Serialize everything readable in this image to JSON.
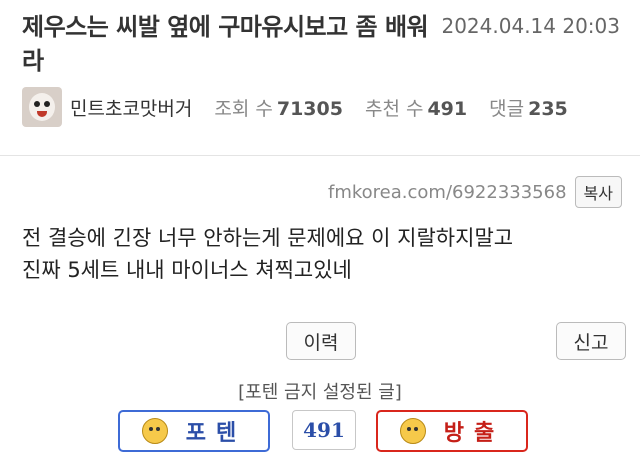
{
  "post": {
    "title": "제우스는 씨발 옆에 구마유시보고 좀 배워라",
    "date": "2024.04.14 20:03",
    "author": "민트초코맛버거",
    "views_label": "조회 수",
    "views": "71305",
    "recommend_label": "추천 수",
    "recommend": "491",
    "comments_label": "댓글",
    "comments": "235",
    "url": "fmkorea.com/6922333568",
    "copy_label": "복사",
    "body_line1": "전 결승에 긴장 너무 안하는게 문제에요 이 지랄하지말고",
    "body_line2": "진짜 5세트 내내 마이너스 쳐찍고있네"
  },
  "actions": {
    "history_label": "이력",
    "report_label": "신고",
    "notice": "[포텐 금지 설정된 글]",
    "upvote_label": "포텐",
    "downvote_label": "방출",
    "vote_count": "491"
  },
  "colors": {
    "upvote": "#3e6bd6",
    "downvote": "#d9261c"
  },
  "icons": {
    "upvote_icon": "thumbs-up-face-icon",
    "downvote_icon": "thumbs-down-face-icon"
  }
}
